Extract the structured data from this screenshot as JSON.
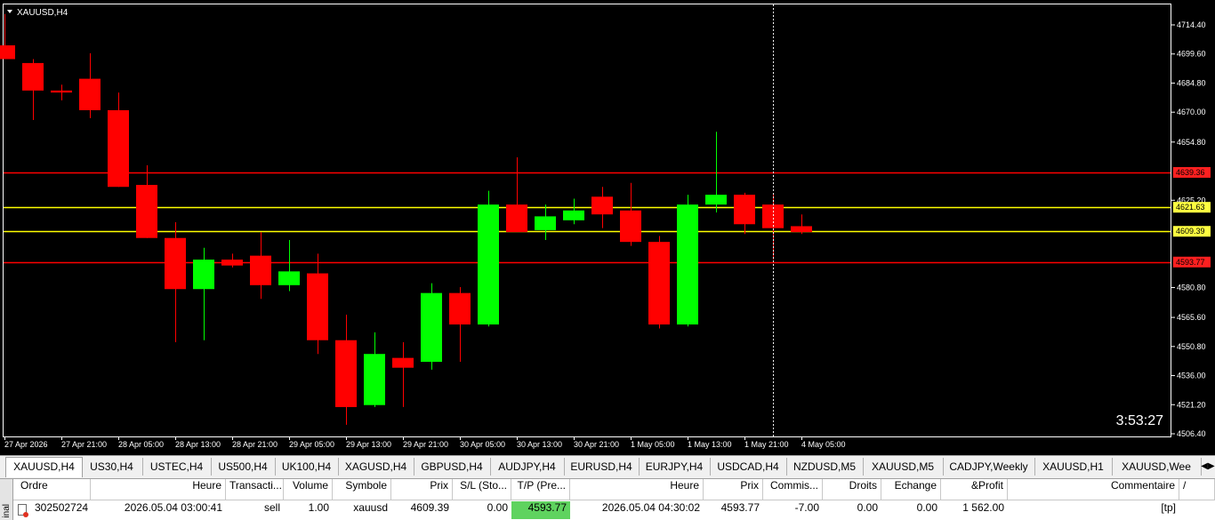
{
  "chart": {
    "title": "XAUUSD,H4",
    "countdown": "3:53:27",
    "price_labels": [
      "4714.40",
      "4699.60",
      "4684.80",
      "4670.00",
      "4654.80",
      "4625.20",
      "4580.80",
      "4565.60",
      "4550.80",
      "4536.00",
      "4521.20",
      "4506.40"
    ],
    "level_labels": [
      {
        "text": "4639.36",
        "color": "#ff2020"
      },
      {
        "text": "4621.63",
        "color": "#ffff40"
      },
      {
        "text": "4609.39",
        "color": "#ffff40"
      },
      {
        "text": "4593.77",
        "color": "#ff2020"
      }
    ],
    "time_labels": [
      "27 Apr 2026",
      "27 Apr 21:00",
      "28 Apr 05:00",
      "28 Apr 13:00",
      "28 Apr 21:00",
      "29 Apr 05:00",
      "29 Apr 13:00",
      "29 Apr 21:00",
      "30 Apr 05:00",
      "30 Apr 13:00",
      "30 Apr 21:00",
      "1 May 05:00",
      "1 May 13:00",
      "1 May 21:00",
      "4 May 05:00"
    ],
    "colors": {
      "bull": "#00ff00",
      "bear": "#ff0000",
      "grid": "#ffffff",
      "bg": "#000000"
    }
  },
  "chart_data": {
    "type": "candlestick",
    "symbol": "XAUUSD",
    "timeframe": "H4",
    "ylim": [
      4506.4,
      4720
    ],
    "levels": [
      4639.36,
      4621.63,
      4609.39,
      4593.77
    ],
    "candles": [
      {
        "o": 4704,
        "h": 4720,
        "l": 4700,
        "c": 4697
      },
      {
        "o": 4695,
        "h": 4697,
        "l": 4666,
        "c": 4681
      },
      {
        "o": 4681,
        "h": 4684,
        "l": 4676,
        "c": 4680
      },
      {
        "o": 4687,
        "h": 4700,
        "l": 4667,
        "c": 4671
      },
      {
        "o": 4671,
        "h": 4680,
        "l": 4632,
        "c": 4632
      },
      {
        "o": 4633,
        "h": 4643,
        "l": 4606,
        "c": 4606
      },
      {
        "o": 4606,
        "h": 4614,
        "l": 4553,
        "c": 4580
      },
      {
        "o": 4580,
        "h": 4601,
        "l": 4554,
        "c": 4595
      },
      {
        "o": 4595,
        "h": 4598,
        "l": 4591,
        "c": 4592
      },
      {
        "o": 4597,
        "h": 4609,
        "l": 4575,
        "c": 4582
      },
      {
        "o": 4582,
        "h": 4605,
        "l": 4579,
        "c": 4589
      },
      {
        "o": 4588,
        "h": 4598,
        "l": 4547,
        "c": 4554
      },
      {
        "o": 4554,
        "h": 4567,
        "l": 4511,
        "c": 4520
      },
      {
        "o": 4521,
        "h": 4558,
        "l": 4520,
        "c": 4547
      },
      {
        "o": 4545,
        "h": 4553,
        "l": 4520,
        "c": 4540
      },
      {
        "o": 4543,
        "h": 4583,
        "l": 4539,
        "c": 4578
      },
      {
        "o": 4578,
        "h": 4581,
        "l": 4543,
        "c": 4562
      },
      {
        "o": 4562,
        "h": 4630,
        "l": 4561,
        "c": 4623
      },
      {
        "o": 4623,
        "h": 4647,
        "l": 4609,
        "c": 4609
      },
      {
        "o": 4610,
        "h": 4623,
        "l": 4605,
        "c": 4617
      },
      {
        "o": 4615,
        "h": 4626,
        "l": 4613,
        "c": 4620
      },
      {
        "o": 4627,
        "h": 4632,
        "l": 4611,
        "c": 4618
      },
      {
        "o": 4620,
        "h": 4634,
        "l": 4602,
        "c": 4604
      },
      {
        "o": 4604,
        "h": 4607,
        "l": 4560,
        "c": 4562
      },
      {
        "o": 4562,
        "h": 4628,
        "l": 4561,
        "c": 4623
      },
      {
        "o": 4623,
        "h": 4660,
        "l": 4619,
        "c": 4628
      },
      {
        "o": 4628,
        "h": 4629,
        "l": 4608,
        "c": 4613
      },
      {
        "o": 4623,
        "h": 4628,
        "l": 4595,
        "c": 4611
      },
      {
        "o": 4612,
        "h": 4618,
        "l": 4608,
        "c": 4609
      }
    ]
  },
  "tabs": [
    "XAUUSD,H4",
    "US30,H4",
    "USTEC,H4",
    "US500,H4",
    "UK100,H4",
    "XAGUSD,H4",
    "GBPUSD,H4",
    "AUDJPY,H4",
    "EURUSD,H4",
    "EURJPY,H4",
    "USDCAD,H4",
    "NZDUSD,M5",
    "XAUUSD,M5",
    "CADJPY,Weekly",
    "XAUUSD,H1",
    "XAUUSD,Wee"
  ],
  "tab_scroll": "◀▶",
  "terminal": {
    "side_label": "inal",
    "headers": [
      "Ordre",
      "Heure",
      "Transacti...",
      "Volume",
      "Symbole",
      "Prix",
      "S/L (Sto...",
      "T/P (Pre...",
      "Heure",
      "Prix",
      "Commis...",
      "Droits",
      "Echange",
      "&Profit",
      "Commentaire",
      "/"
    ],
    "row": [
      "302502724",
      "2026.05.04 03:00:41",
      "sell",
      "1.00",
      "xauusd",
      "4609.39",
      "0.00",
      "4593.77",
      "2026.05.04 04:30:02",
      "4593.77",
      "-7.00",
      "0.00",
      "0.00",
      "1 562.00",
      "[tp]"
    ]
  }
}
